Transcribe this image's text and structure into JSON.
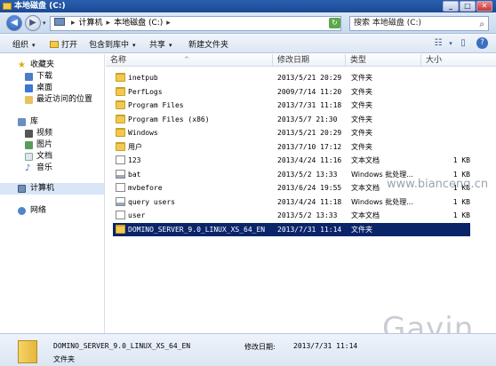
{
  "window": {
    "title": "本地磁盘 (C:)"
  },
  "address": {
    "crumbs": [
      "计算机",
      "本地磁盘 (C:)"
    ]
  },
  "search": {
    "placeholder": "搜索 本地磁盘 (C:)"
  },
  "toolbar": {
    "organize": "组织",
    "open": "打开",
    "include_in_library": "包含到库中",
    "share": "共享",
    "new_folder": "新建文件夹"
  },
  "nav": {
    "favorites": "收藏夹",
    "downloads": "下载",
    "desktop": "桌面",
    "recent": "最近访问的位置",
    "libraries": "库",
    "videos": "视频",
    "pictures": "图片",
    "documents": "文档",
    "music": "音乐",
    "computer": "计算机",
    "network": "网络"
  },
  "columns": {
    "name": "名称",
    "date": "修改日期",
    "type": "类型",
    "size": "大小"
  },
  "files": [
    {
      "name": "inetpub",
      "date": "2013/5/21 20:29",
      "type": "文件夹",
      "size": "",
      "kind": "folder"
    },
    {
      "name": "PerfLogs",
      "date": "2009/7/14 11:20",
      "type": "文件夹",
      "size": "",
      "kind": "folder"
    },
    {
      "name": "Program Files",
      "date": "2013/7/31 11:18",
      "type": "文件夹",
      "size": "",
      "kind": "folder"
    },
    {
      "name": "Program Files (x86)",
      "date": "2013/5/7 21:30",
      "type": "文件夹",
      "size": "",
      "kind": "folder"
    },
    {
      "name": "Windows",
      "date": "2013/5/21 20:29",
      "type": "文件夹",
      "size": "",
      "kind": "folder"
    },
    {
      "name": "用户",
      "date": "2013/7/10 17:12",
      "type": "文件夹",
      "size": "",
      "kind": "folder"
    },
    {
      "name": "123",
      "date": "2013/4/24 11:16",
      "type": "文本文档",
      "size": "1 KB",
      "kind": "file"
    },
    {
      "name": "bat",
      "date": "2013/5/2 13:33",
      "type": "Windows 批处理...",
      "size": "1 KB",
      "kind": "bat"
    },
    {
      "name": "mvbefore",
      "date": "2013/6/24 19:55",
      "type": "文本文档",
      "size": "1 KB",
      "kind": "file"
    },
    {
      "name": "query users",
      "date": "2013/4/24 11:18",
      "type": "Windows 批处理...",
      "size": "1 KB",
      "kind": "bat"
    },
    {
      "name": "user",
      "date": "2013/5/2 13:33",
      "type": "文本文档",
      "size": "1 KB",
      "kind": "file"
    },
    {
      "name": "DOMINO_SERVER_9.0_LINUX_XS_64_EN",
      "date": "2013/7/31 11:14",
      "type": "文件夹",
      "size": "",
      "kind": "folder",
      "selected": true
    }
  ],
  "details": {
    "name": "DOMINO_SERVER_9.0_LINUX_XS_64_EN",
    "date_label": "修改日期:",
    "date": "2013/7/31 11:14",
    "type": "文件夹"
  },
  "watermarks": {
    "url": "www.bianceng.cn",
    "name": "Gavin"
  }
}
